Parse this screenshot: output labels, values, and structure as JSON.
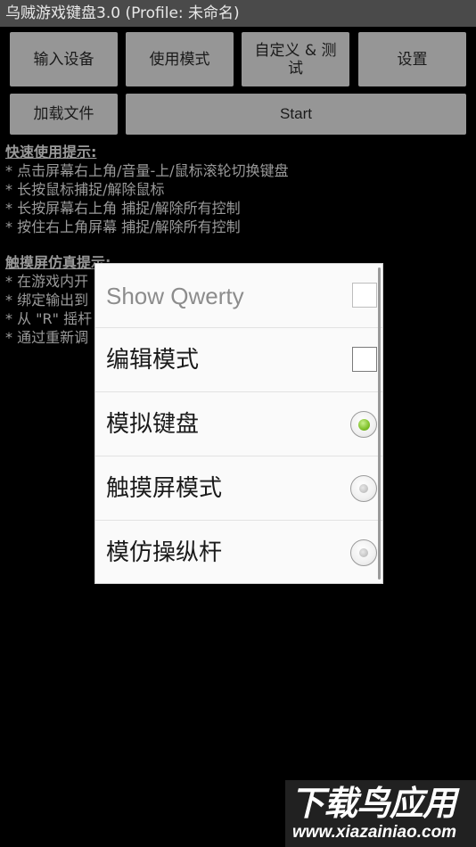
{
  "app": {
    "title": "乌贼游戏键盘3.0 (Profile: 未命名)"
  },
  "buttons": {
    "input_device": "输入设备",
    "use_mode": "使用模式",
    "custom_test": "自定义 & 测试",
    "settings": "设置",
    "load_file": "加载文件",
    "start": "Start"
  },
  "tips": {
    "quick_heading": "快速使用提示:",
    "quick_lines": [
      "* 点击屏幕右上角/音量-上/鼠标滚轮切换键盘",
      "* 长按鼠标捕捉/解除鼠标",
      "* 长按屏幕右上角 捕捉/解除所有控制",
      "* 按住右上角屏幕 捕捉/解除所有控制"
    ],
    "touch_heading": "触摸屏仿真提示:",
    "touch_lines": [
      "* 在游戏内开",
      "* 绑定输出到",
      "* 从 \"R\" 摇杆",
      "* 通过重新调"
    ]
  },
  "dialog": {
    "items": [
      {
        "label": "Show Qwerty",
        "control": "checkbox",
        "checked": false,
        "enabled": false
      },
      {
        "label": "编辑模式",
        "control": "checkbox",
        "checked": false,
        "enabled": true
      },
      {
        "label": "模拟键盘",
        "control": "radio",
        "checked": true,
        "enabled": true
      },
      {
        "label": "触摸屏模式",
        "control": "radio",
        "checked": false,
        "enabled": true
      },
      {
        "label": "模仿操纵杆",
        "control": "radio",
        "checked": false,
        "enabled": true
      }
    ]
  },
  "watermark": {
    "brand": "下载鸟应用",
    "url": "www.xiazainiao.com"
  },
  "colors": {
    "background": "#000000",
    "title_bar": "#4a4a4a",
    "button": "#969696",
    "tip_text": "#9a9a9a",
    "dialog_bg": "#fafafa",
    "radio_selected": "#7fc02a"
  }
}
